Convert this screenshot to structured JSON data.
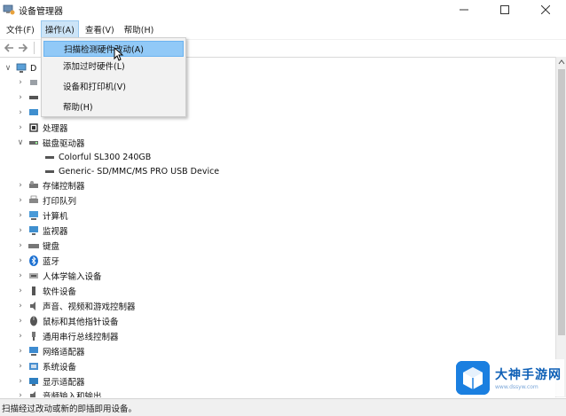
{
  "window": {
    "title": "设备管理器",
    "controls": [
      "minimize",
      "maximize",
      "close"
    ]
  },
  "menubar": {
    "items": [
      {
        "label": "文件(F)"
      },
      {
        "label": "操作(A)"
      },
      {
        "label": "查看(V)"
      },
      {
        "label": "帮助(H)"
      }
    ],
    "active_index": 1
  },
  "toolbar": {
    "buttons": [
      "back-arrow-icon",
      "forward-arrow-icon"
    ]
  },
  "tree": {
    "root_label": "D",
    "items": [
      {
        "label": "",
        "icon": "audio-io-icon",
        "expanded": false
      },
      {
        "label": "",
        "icon": "disk-icon",
        "expanded": false
      },
      {
        "label": "",
        "icon": "monitor-icon",
        "expanded": false
      },
      {
        "label": "处理器",
        "icon": "processor-icon",
        "expanded": false
      },
      {
        "label": "磁盘驱动器",
        "icon": "disk-drive-icon",
        "expanded": true
      },
      {
        "label": "Colorful SL300 240GB",
        "icon": "drive-item-icon",
        "child": true
      },
      {
        "label": "Generic- SD/MMC/MS PRO USB Device",
        "icon": "drive-item-icon",
        "child": true
      },
      {
        "label": "存储控制器",
        "icon": "storage-controller-icon",
        "expanded": false
      },
      {
        "label": "打印队列",
        "icon": "printer-icon",
        "expanded": false
      },
      {
        "label": "计算机",
        "icon": "computer-icon",
        "expanded": false
      },
      {
        "label": "监视器",
        "icon": "monitor-icon",
        "expanded": false
      },
      {
        "label": "键盘",
        "icon": "keyboard-icon",
        "expanded": false
      },
      {
        "label": "蓝牙",
        "icon": "bluetooth-icon",
        "expanded": false
      },
      {
        "label": "人体学输入设备",
        "icon": "hid-icon",
        "expanded": false
      },
      {
        "label": "软件设备",
        "icon": "software-device-icon",
        "expanded": false
      },
      {
        "label": "声音、视频和游戏控制器",
        "icon": "sound-icon",
        "expanded": false
      },
      {
        "label": "鼠标和其他指针设备",
        "icon": "mouse-icon",
        "expanded": false
      },
      {
        "label": "通用串行总线控制器",
        "icon": "usb-icon",
        "expanded": false
      },
      {
        "label": "网络适配器",
        "icon": "network-icon",
        "expanded": false
      },
      {
        "label": "系统设备",
        "icon": "system-device-icon",
        "expanded": false
      },
      {
        "label": "显示适配器",
        "icon": "display-adapter-icon",
        "expanded": false
      },
      {
        "label": "音频输入和输出",
        "icon": "audio-io-icon",
        "expanded": false
      }
    ]
  },
  "dropdown": {
    "items": [
      {
        "label": "扫描检测硬件改动(A)",
        "highlighted": true
      },
      {
        "label": "添加过时硬件(L)",
        "highlighted": false
      },
      {
        "label": "设备和打印机(V)",
        "highlighted": false
      },
      {
        "label": "帮助(H)",
        "highlighted": false
      }
    ]
  },
  "statusbar": {
    "text": "扫描经过改动或新的即插即用设备。"
  },
  "watermark": {
    "title": "大神手游网",
    "subtitle": "www.dssyw.com"
  },
  "colors": {
    "menu_active_bg": "#cce4f7",
    "dropdown_highlight": "#91c9f7",
    "watermark_blue": "#1a7fe0"
  }
}
